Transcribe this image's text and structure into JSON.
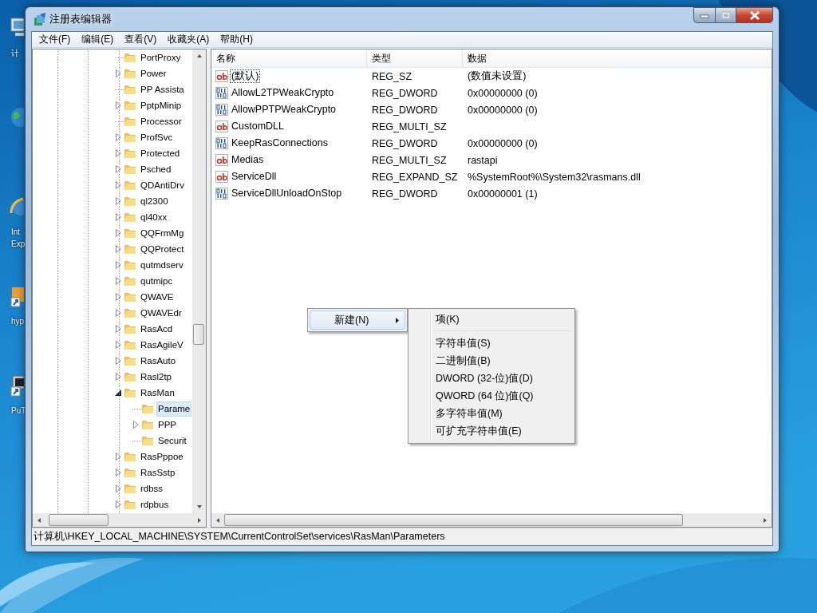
{
  "desktop": {
    "icons": [
      {
        "kind": "computer",
        "label_lines": [
          "计"
        ]
      },
      {
        "kind": "network"
      },
      {
        "kind": "browser",
        "label_lines": [
          "Int",
          "Exp"
        ]
      },
      {
        "kind": "shortcut",
        "label_lines": [
          "hyp"
        ]
      },
      {
        "kind": "putty",
        "label_lines": [
          "PuT"
        ]
      }
    ]
  },
  "window": {
    "title": "注册表编辑器",
    "menu": [
      "文件(F)",
      "编辑(E)",
      "查看(V)",
      "收藏夹(A)",
      "帮助(H)"
    ],
    "tree": {
      "items": [
        {
          "label": "PortProxy",
          "expandable": false,
          "selected": false
        },
        {
          "label": "Power",
          "expandable": true,
          "expanded": false,
          "selected": false
        },
        {
          "label": "PP Assista",
          "expandable": false,
          "selected": false
        },
        {
          "label": "PptpMinip",
          "expandable": true,
          "expanded": false,
          "selected": false
        },
        {
          "label": "Processor",
          "expandable": false,
          "selected": false
        },
        {
          "label": "ProfSvc",
          "expandable": true,
          "expanded": false,
          "selected": false
        },
        {
          "label": "Protected",
          "expandable": true,
          "expanded": false,
          "selected": false
        },
        {
          "label": "Psched",
          "expandable": true,
          "expanded": false,
          "selected": false
        },
        {
          "label": "QDAntiDrv",
          "expandable": true,
          "expanded": false,
          "selected": false
        },
        {
          "label": "ql2300",
          "expandable": true,
          "expanded": false,
          "selected": false
        },
        {
          "label": "ql40xx",
          "expandable": true,
          "expanded": false,
          "selected": false
        },
        {
          "label": "QQFrmMg",
          "expandable": true,
          "expanded": false,
          "selected": false
        },
        {
          "label": "QQProtect",
          "expandable": true,
          "expanded": false,
          "selected": false
        },
        {
          "label": "qutmdserv",
          "expandable": true,
          "expanded": false,
          "selected": false
        },
        {
          "label": "qutmipc",
          "expandable": true,
          "expanded": false,
          "selected": false
        },
        {
          "label": "QWAVE",
          "expandable": true,
          "expanded": false,
          "selected": false
        },
        {
          "label": "QWAVEdr",
          "expandable": true,
          "expanded": false,
          "selected": false
        },
        {
          "label": "RasAcd",
          "expandable": true,
          "expanded": false,
          "selected": false
        },
        {
          "label": "RasAgileV",
          "expandable": true,
          "expanded": false,
          "selected": false
        },
        {
          "label": "RasAuto",
          "expandable": true,
          "expanded": false,
          "selected": false
        },
        {
          "label": "Rasl2tp",
          "expandable": true,
          "expanded": false,
          "selected": false
        },
        {
          "label": "RasMan",
          "expandable": true,
          "expanded": true,
          "selected": false,
          "children": [
            {
              "label": "Parame",
              "expandable": false,
              "selected": true
            },
            {
              "label": "PPP",
              "expandable": true,
              "expanded": false,
              "selected": false
            },
            {
              "label": "Securit",
              "expandable": false,
              "selected": false
            }
          ]
        },
        {
          "label": "RasPppoe",
          "expandable": true,
          "expanded": false,
          "selected": false
        },
        {
          "label": "RasSstp",
          "expandable": true,
          "expanded": false,
          "selected": false
        },
        {
          "label": "rdbss",
          "expandable": true,
          "expanded": false,
          "selected": false
        },
        {
          "label": "rdpbus",
          "expandable": true,
          "expanded": false,
          "selected": false
        }
      ]
    },
    "values": {
      "columns": [
        "名称",
        "类型",
        "数据"
      ],
      "rows": [
        {
          "kind": "string",
          "name": "(默认)",
          "type": "REG_SZ",
          "data": "(数值未设置)",
          "focused": true
        },
        {
          "kind": "binary",
          "name": "AllowL2TPWeakCrypto",
          "type": "REG_DWORD",
          "data": "0x00000000 (0)",
          "focused": false
        },
        {
          "kind": "binary",
          "name": "AllowPPTPWeakCrypto",
          "type": "REG_DWORD",
          "data": "0x00000000 (0)",
          "focused": false
        },
        {
          "kind": "string",
          "name": "CustomDLL",
          "type": "REG_MULTI_SZ",
          "focused": false
        },
        {
          "kind": "binary",
          "name": "KeepRasConnections",
          "type": "REG_DWORD",
          "data": "0x00000000 (0)",
          "focused": false
        },
        {
          "kind": "string",
          "name": "Medias",
          "type": "REG_MULTI_SZ",
          "data": "rastapi",
          "focused": false
        },
        {
          "kind": "string",
          "name": "ServiceDll",
          "type": "REG_EXPAND_SZ",
          "data": "%SystemRoot%\\System32\\rasmans.dll",
          "focused": false
        },
        {
          "kind": "binary",
          "name": "ServiceDllUnloadOnStop",
          "type": "REG_DWORD",
          "data": "0x00000001 (1)",
          "focused": false
        }
      ]
    },
    "status_bar": "计算机\\HKEY_LOCAL_MACHINE\\SYSTEM\\CurrentControlSet\\services\\RasMan\\Parameters"
  },
  "context_menu": {
    "items": [
      {
        "label": "新建(N)",
        "has_submenu": true,
        "highlighted": true
      }
    ],
    "submenu": {
      "items": [
        {
          "kind": "item",
          "label": "项(K)"
        },
        {
          "kind": "separator"
        },
        {
          "kind": "item",
          "label": "字符串值(S)"
        },
        {
          "kind": "item",
          "label": "二进制值(B)"
        },
        {
          "kind": "item",
          "label": "DWORD (32-位)值(D)"
        },
        {
          "kind": "item",
          "label": "QWORD (64 位)值(Q)"
        },
        {
          "kind": "item",
          "label": "多字符串值(M)"
        },
        {
          "kind": "item",
          "label": "可扩充字符串值(E)"
        }
      ]
    }
  }
}
